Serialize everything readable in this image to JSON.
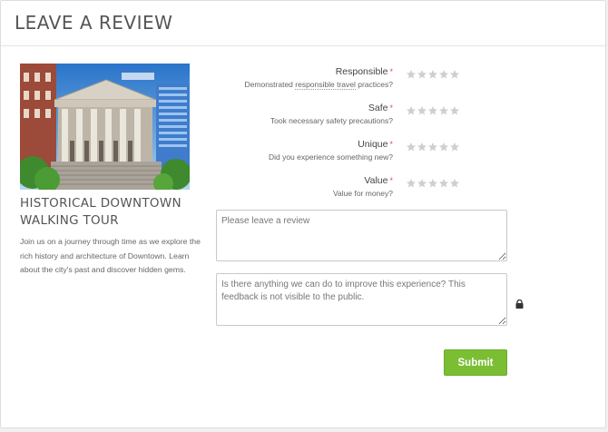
{
  "header": {
    "title": "LEAVE A REVIEW"
  },
  "tour": {
    "title": "HISTORICAL DOWNTOWN WALKING TOUR",
    "description": "Join us on a journey through time as we explore the rich history and architecture of Downtown. Learn about the city's past and discover hidden gems."
  },
  "ratings": [
    {
      "label": "Responsible",
      "required": "*",
      "sub_before": "Demonstrated ",
      "sub_link": "responsible travel",
      "sub_after": " practices?",
      "stars": 0,
      "max": 5
    },
    {
      "label": "Safe",
      "required": "*",
      "sub": "Took necessary safety precautions?",
      "stars": 0,
      "max": 5
    },
    {
      "label": "Unique",
      "required": "*",
      "sub": "Did you experience something new?",
      "stars": 0,
      "max": 5
    },
    {
      "label": "Value",
      "required": "*",
      "sub": "Value for money?",
      "stars": 0,
      "max": 5
    }
  ],
  "review_field": {
    "placeholder": "Please leave a review",
    "value": ""
  },
  "feedback_field": {
    "placeholder": "Is there anything we can do to improve this experience? This feedback is not visible to the public.",
    "value": ""
  },
  "submit": {
    "label": "Submit"
  },
  "colors": {
    "accent": "#7bbe34",
    "required": "#d9534f",
    "star_empty": "#cfcfcf"
  },
  "icons": {
    "star": "star-icon",
    "lock": "lock-icon"
  }
}
